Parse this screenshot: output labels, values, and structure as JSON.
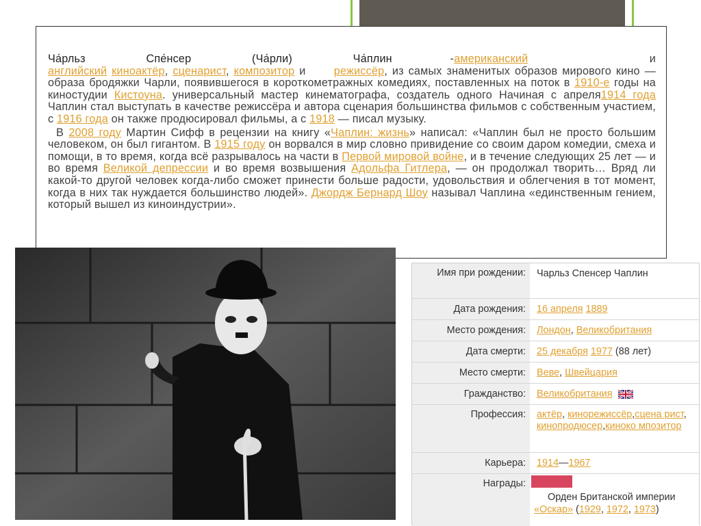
{
  "intro": {
    "name": "Ча́рльз Спе́нсер (Ча́рли) Ча́плин",
    "dash": "-",
    "american": "американский",
    "and1": "и",
    "english": "английский",
    "actor": "киноактёр",
    "comma1": ",",
    "writer": "сценарист",
    "comma2": ",",
    "composer": "композитор",
    "and2": "и",
    "director": "режиссёр",
    "t1": ", из самых знаменитых образов мирового кино — образа бродяжки Чарли, появившегося в короткометражных комедиях, поставленных на поток в",
    "y1910": "1910-е",
    "t2": "годы на киностудии",
    "keystone": "Кистоуна",
    "t3": ". универсальный мастер кинематографа, создатель одного Начиная с апреля",
    "y1914": "1914 года",
    "t4": "Чаплин стал выступать в качестве режиссёра и автора сценария большинства фильмов с собственным участием, с",
    "y1916": "1916 года",
    "t5": "он также продюсировал фильмы, а с",
    "y1918": "1918",
    "t6": "— писал музыку."
  },
  "para2": {
    "in": "В",
    "y2008": "2008 году",
    "t1": "Мартин Сифф в рецензии на книгу «",
    "book": "Чаплин: жизнь",
    "t2": "» написал: «Чаплин был не просто большим человеком, он был гигантом. В",
    "y1915": "1915 году",
    "t3": "он ворвался в мир словно привидение со своим даром комедии, смеха и помощи, в то время, когда всё разрывалось на части в",
    "ww1": "Первой мировой войне",
    "t4": ", и в течение следующих 25 лет — и во время",
    "depr": "Великой депрессии",
    "t5": "и во время возвышения",
    "hitler": "Адольфа Гитлера",
    "t6": ", — он продолжал творить… Вряд ли какой-то другой человек когда-либо сможет принести больше радости, удовольствия и облегчения в тот момент, когда в них так нуждается большинство людей».",
    "shaw": "Джордж Бернард Шоу",
    "t7": "называл Чаплина «единственным гением, который вышел из киноиндустрии»."
  },
  "infobox": {
    "birthname_label": "Имя при рождении:",
    "birthname_value": "Чарльз Спенсер Чаплин",
    "birthdate_label": "Дата рождения:",
    "birthdate_day": "16 апреля",
    "birthdate_year": "1889",
    "birthplace_label": "Место рождения:",
    "birthplace_city": "Лондон",
    "birthplace_sep": ",",
    "birthplace_country": "Великобритания",
    "deathdate_label": "Дата смерти:",
    "deathdate_day": "25 декабря",
    "deathdate_year": "1977",
    "deathdate_age": "(88 лет)",
    "deathplace_label": "Место смерти:",
    "deathplace_city": "Веве",
    "deathplace_sep": ",",
    "deathplace_country": "Швейцария",
    "citizenship_label": "Гражданство:",
    "citizenship_value": "Великобритания",
    "profession_label": "Профессия:",
    "prof1": "актёр",
    "prof2": "кинорежиссёр",
    "prof3": "сцена рист",
    "prof4": "кинопродюсер",
    "prof5": "киноко мпозитор",
    "career_label": "Карьера:",
    "career_start": "1914",
    "career_dash": "—",
    "career_end": "1967",
    "awards_label": "Награды:",
    "award1": "Орден Британской империи",
    "oscar": "«Оскар»",
    "oscar_open": "(",
    "oscar_y1": "1929",
    "oscar_y2": "1972",
    "oscar_y3": "1973",
    "oscar_close": ")",
    "link_color": "#e0a030"
  }
}
